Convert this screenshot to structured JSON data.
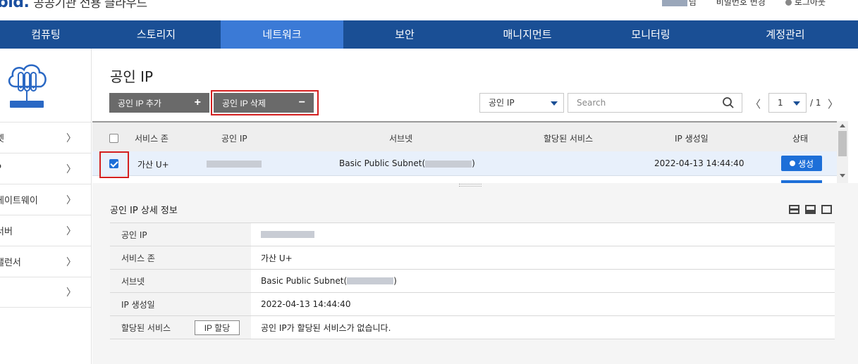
{
  "header": {
    "brand": "bld.",
    "brand_sub": "공공기관 전용 클라우드",
    "user_suffix": "님",
    "change_password": "비밀번호 변경",
    "logout": "로그아웃"
  },
  "nav": [
    {
      "label": "컴퓨팅"
    },
    {
      "label": "스토리지"
    },
    {
      "label": "네트워크",
      "active": true
    },
    {
      "label": "보안"
    },
    {
      "label": "매니지먼트"
    },
    {
      "label": "모니터링"
    },
    {
      "label": "계정관리"
    }
  ],
  "sidebar": {
    "items": [
      {
        "label": "넷"
      },
      {
        "label": "P"
      },
      {
        "label": "게이트웨이"
      },
      {
        "label": "서버"
      },
      {
        "label": "밸런서"
      },
      {
        "label": ""
      }
    ]
  },
  "page": {
    "title": "공인 IP",
    "add_button": "공인 IP 추가",
    "delete_button": "공인 IP 삭제",
    "filter_value": "공인 IP",
    "search_placeholder": "Search",
    "page_current": "1",
    "page_total": "/ 1"
  },
  "table": {
    "columns": [
      "서비스 존",
      "공인 IP",
      "서브넷",
      "할당된 서비스",
      "IP 생성일",
      "상태"
    ],
    "rows": [
      {
        "zone": "가산 U+",
        "subnet": "Basic Public Subnet(",
        "subnet_close": ")",
        "service": "",
        "created": "2022-04-13 14:44:40",
        "status": "생성",
        "checked": true
      }
    ]
  },
  "detail": {
    "title": "공인 IP 상세 정보",
    "rows": [
      {
        "label": "공인 IP",
        "value": ""
      },
      {
        "label": "서비스 존",
        "value": "가산 U+"
      },
      {
        "label": "서브넷",
        "value": "Basic Public Subnet(",
        "value_close": ")"
      },
      {
        "label": "IP 생성일",
        "value": "2022-04-13 14:44:40"
      },
      {
        "label": "할당된 서비스",
        "value": "공인 IP가 할당된 서비스가 없습니다.",
        "button": "IP 할당"
      }
    ]
  },
  "colors": {
    "nav_bg": "#1a4f95",
    "nav_active": "#3b7ad6",
    "status_blue": "#1d6fd8",
    "highlight_red": "#d42020"
  }
}
